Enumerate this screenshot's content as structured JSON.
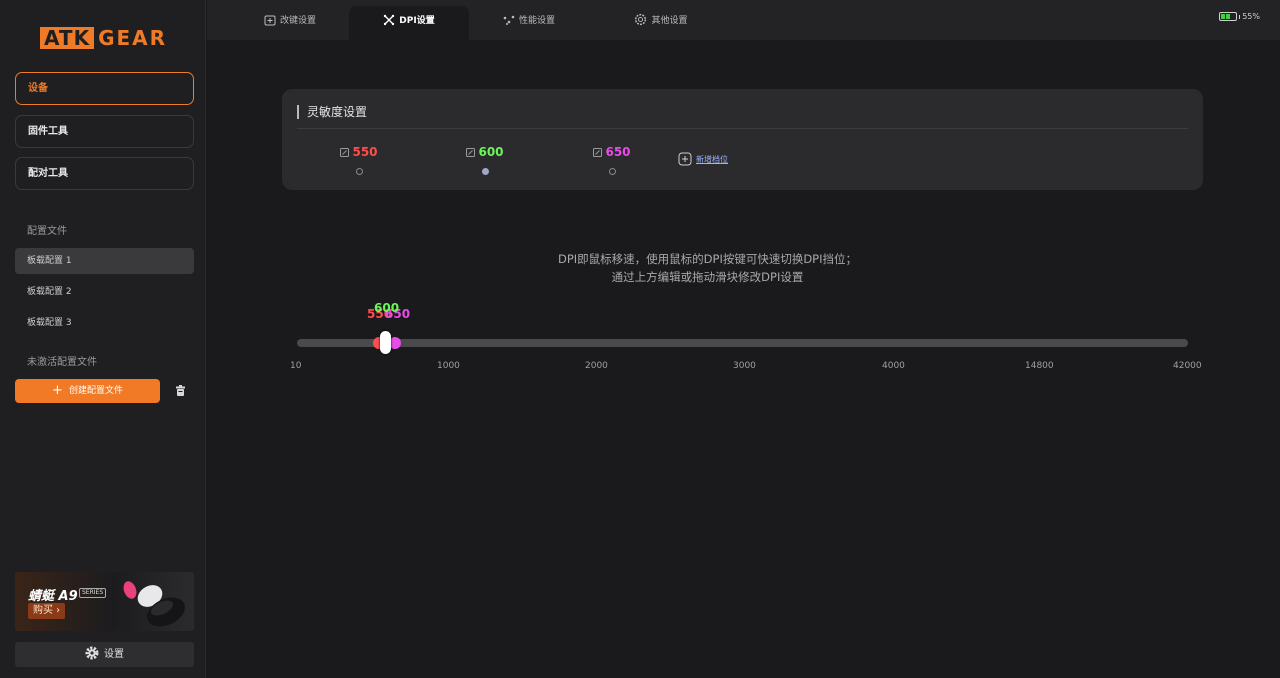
{
  "sidebar": {
    "logo_left": "ATK",
    "logo_right": "GEAR",
    "nav": [
      {
        "label": "设备",
        "active": true
      },
      {
        "label": "固件工具",
        "active": false
      },
      {
        "label": "配对工具",
        "active": false
      }
    ],
    "profiles_label": "配置文件",
    "profiles": [
      {
        "label": "板载配置 1",
        "active": true
      },
      {
        "label": "板载配置 2",
        "active": false
      },
      {
        "label": "板载配置 3",
        "active": false
      }
    ],
    "inactive_label": "未激活配置文件",
    "create_button": "创建配置文件",
    "banner": {
      "title": "蜻蜓 A9",
      "series": "SERIES",
      "buy": "购买 ›"
    },
    "settings_button": "设置"
  },
  "topbar": {
    "tabs": [
      {
        "label": "改键设置",
        "icon": "keymap-icon",
        "active": false
      },
      {
        "label": "DPI设置",
        "icon": "dpi-icon",
        "active": true
      },
      {
        "label": "性能设置",
        "icon": "performance-icon",
        "active": false
      },
      {
        "label": "其他设置",
        "icon": "gear-icon",
        "active": false
      }
    ],
    "battery": "55%"
  },
  "sensitivity": {
    "title": "灵敏度设置",
    "levels": [
      {
        "value": "550",
        "color": "#ff4d4d",
        "selected": false
      },
      {
        "value": "600",
        "color": "#6cf55a",
        "selected": true
      },
      {
        "value": "650",
        "color": "#e84ce8",
        "selected": false
      }
    ],
    "add_level": "新增档位"
  },
  "hint": {
    "line1": "DPI即鼠标移速，使用鼠标的DPI按键可快速切换DPI挡位；",
    "line2": "通过上方编辑或拖动滑块修改DPI设置"
  },
  "slider": {
    "ticks": [
      "10",
      "1000",
      "2000",
      "3000",
      "4000",
      "14800",
      "42000"
    ],
    "labels": {
      "level1": "550",
      "level2": "600",
      "level3": "650"
    }
  }
}
